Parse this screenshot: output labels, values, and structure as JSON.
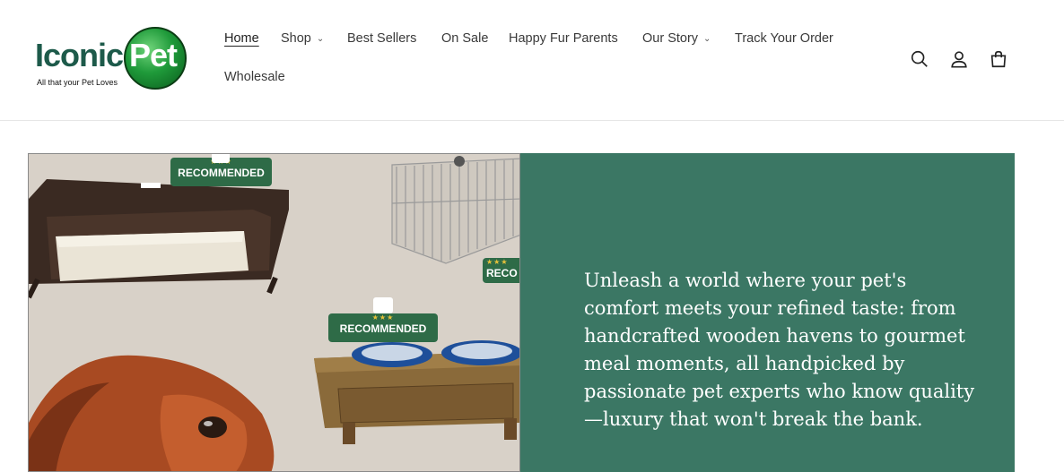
{
  "logo": {
    "name_part1": "Iconic",
    "name_part2": "Pet",
    "tagline": "All that your  Pet Loves"
  },
  "nav": {
    "items": [
      {
        "label": "Home",
        "active": true,
        "dropdown": false
      },
      {
        "label": "Shop",
        "active": false,
        "dropdown": true
      },
      {
        "label": "Best Sellers",
        "active": false,
        "dropdown": false
      },
      {
        "label": "On Sale",
        "active": false,
        "dropdown": false
      },
      {
        "label": "Happy Fur Parents",
        "active": false,
        "dropdown": false
      },
      {
        "label": "Our Story",
        "active": false,
        "dropdown": true
      },
      {
        "label": "Track Your Order",
        "active": false,
        "dropdown": false
      },
      {
        "label": "Wholesale",
        "active": false,
        "dropdown": false
      }
    ]
  },
  "header_icons": [
    "search-icon",
    "account-icon",
    "cart-icon"
  ],
  "hero": {
    "badge_text": "RECOMMENDED",
    "badge_partial": "RECO",
    "stars": "★★★",
    "text": "Unleash a world where your pet's comfort meets your refined taste: from handcrafted wooden havens to gourmet meal moments, all handpicked by passionate pet experts who know quality—luxury that won't break the bank."
  },
  "colors": {
    "panel_green": "#3b7764",
    "logo_green": "#1d5a4a",
    "image_bg": "#d8d1c8"
  }
}
